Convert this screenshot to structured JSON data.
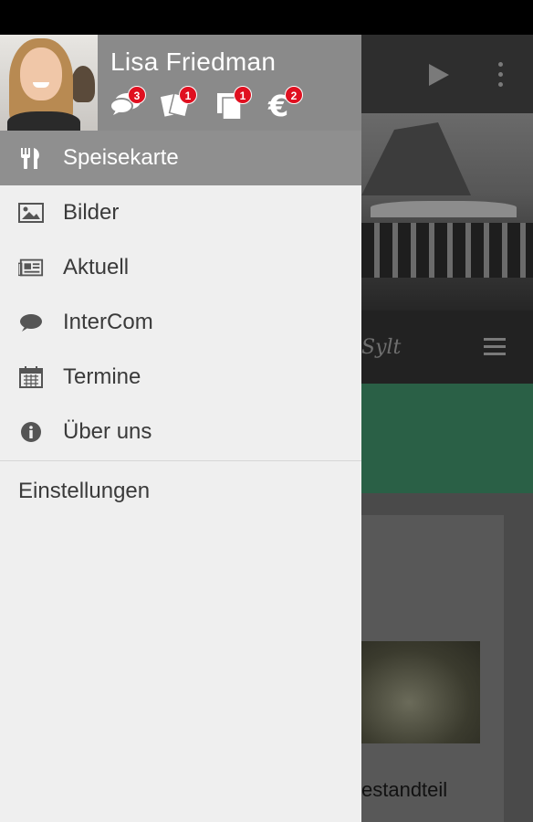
{
  "user": {
    "name": "Lisa Friedman",
    "badges": {
      "messages": "3",
      "vouchers": "1",
      "documents": "1",
      "payments": "2"
    }
  },
  "menu": {
    "items": [
      {
        "label": "Speisekarte",
        "icon": "cutlery-icon",
        "active": true
      },
      {
        "label": "Bilder",
        "icon": "image-icon"
      },
      {
        "label": "Aktuell",
        "icon": "newspaper-icon"
      },
      {
        "label": "InterCom",
        "icon": "chat-bubble-icon"
      },
      {
        "label": "Termine",
        "icon": "calendar-icon"
      },
      {
        "label": "Über uns",
        "icon": "info-icon"
      }
    ],
    "settings_label": "Einstellungen"
  },
  "background": {
    "text_fragment": "estandteil"
  },
  "colors": {
    "drawer_bg": "#efefef",
    "header_bg": "#8a8a8a",
    "active_bg": "#8f8f8f",
    "badge": "#e01020",
    "green_band": "#2a6046"
  }
}
